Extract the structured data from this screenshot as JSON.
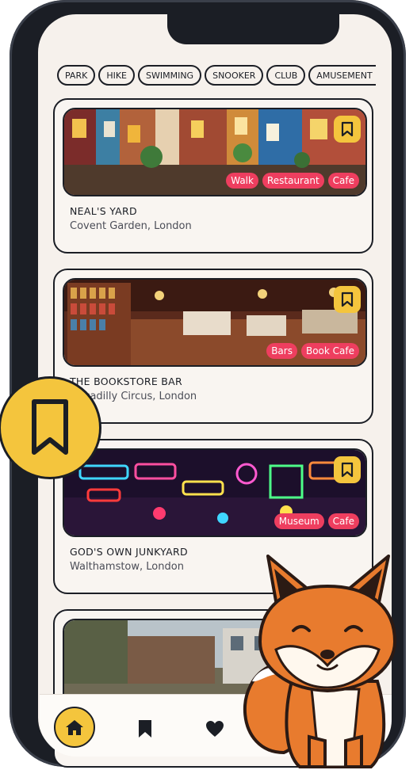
{
  "filters": [
    "PARK",
    "HIKE",
    "SWIMMING",
    "SNOOKER",
    "CLUB",
    "AMUSEMENT PARK"
  ],
  "places": [
    {
      "title": "NEAL'S YARD",
      "location": "Covent Garden, London",
      "tags": [
        "Walk",
        "Restaurant",
        "Cafe"
      ]
    },
    {
      "title": "THE BOOKSTORE BAR",
      "location": "Piccadilly Circus, London",
      "tags": [
        "Bars",
        "Book Cafe"
      ]
    },
    {
      "title": "GOD'S OWN JUNKYARD",
      "location": "Walthamstow, London",
      "tags": [
        "Museum",
        "Cafe"
      ]
    },
    {
      "title": "",
      "location": "",
      "tags": []
    }
  ],
  "nav": [
    {
      "icon": "home-icon",
      "active": true
    },
    {
      "icon": "bookmark-icon",
      "active": false
    },
    {
      "icon": "heart-icon",
      "active": false
    }
  ],
  "colors": {
    "accent": "#f4c53d",
    "tag": "#ee3e5f",
    "dark": "#1b1e25",
    "screen": "#f6f1ec"
  }
}
